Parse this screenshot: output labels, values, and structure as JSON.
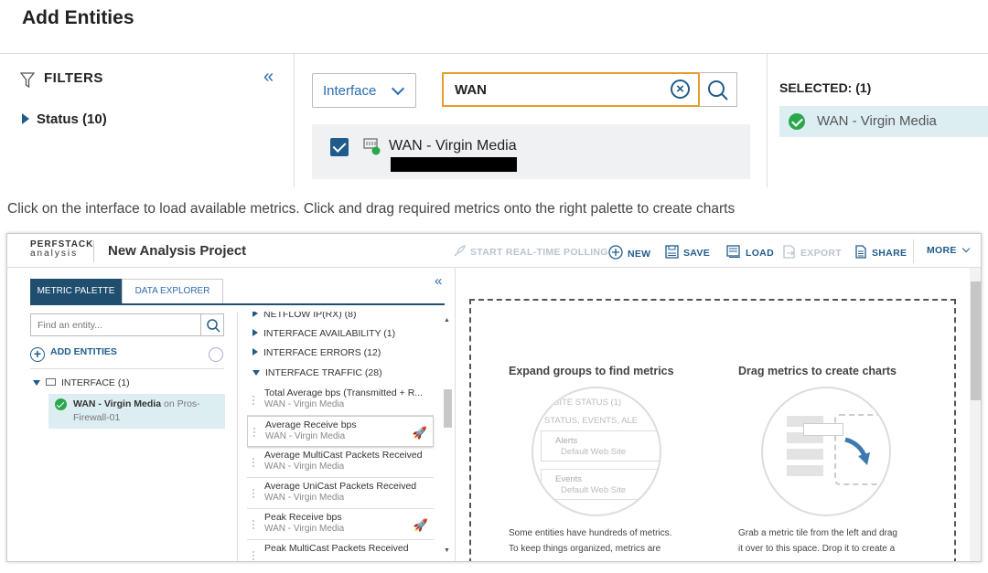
{
  "dialog": {
    "title": "Add Entities",
    "filters_label": "FILTERS",
    "status_filter": "Status (10)",
    "type_select": "Interface",
    "search_value": "WAN",
    "result_label": "WAN - Virgin Media",
    "selected_header": "SELECTED: (1)",
    "selected_item": "WAN - Virgin Media"
  },
  "instruction": "Click on the interface to load available metrics. Click and drag required metrics onto the right palette to create charts",
  "app": {
    "logo_top": "PERFSTACK",
    "logo_bottom": "analysis",
    "project_title": "New Analysis Project",
    "toolbar": {
      "polling": "START REAL-TIME POLLING",
      "new": "NEW",
      "save": "SAVE",
      "load": "LOAD",
      "export": "EXPORT",
      "share": "SHARE",
      "more": "MORE"
    },
    "tabs": {
      "metric_palette": "METRIC PALETTE",
      "data_explorer": "DATA EXPLORER"
    },
    "find_placeholder": "Find an entity...",
    "add_entities": "ADD ENTITIES",
    "interface_group": "INTERFACE (1)",
    "entity": {
      "name": "WAN - Virgin Media",
      "on_text": "on Pros-Firewall-01"
    },
    "groups": [
      "NETFLOW IP(RX) (8)",
      "INTERFACE AVAILABILITY (1)",
      "INTERFACE ERRORS (12)",
      "INTERFACE TRAFFIC (28)"
    ],
    "metrics": [
      {
        "title": "Total Average bps (Transmitted + R...",
        "sub": "WAN - Virgin Media"
      },
      {
        "title": "Average Receive bps",
        "sub": "WAN - Virgin Media"
      },
      {
        "title": "Average MultiCast Packets Received",
        "sub": "WAN - Virgin Media"
      },
      {
        "title": "Average UniCast Packets Received",
        "sub": "WAN - Virgin Media"
      },
      {
        "title": "Peak Receive bps",
        "sub": "WAN - Virgin Media"
      },
      {
        "title": "Peak MultiCast Packets Received",
        "sub": ""
      }
    ],
    "canvas": {
      "expand_title": "Expand groups to find metrics",
      "drag_title": "Drag metrics to create charts",
      "circle_site_status": "SITE STATUS (1)",
      "circle_status_events": "STATUS, EVENTS, ALE",
      "circle_alerts": "Alerts",
      "circle_alerts_sub": "Default Web Site",
      "circle_events": "Events",
      "circle_events_sub": "Default Web Site",
      "desc1_line1": "Some entities have hundreds of metrics.",
      "desc1_line2": "To keep things organized, metrics are",
      "desc2_line1": "Grab a metric tile from the left and drag",
      "desc2_line2": "it over to this space. Drop it to create a"
    }
  },
  "colors": {
    "accent": "#1f5c8b",
    "search_border": "#e79a2e",
    "ok_green": "#2aa74a",
    "selected_bg": "#ddeef3"
  }
}
